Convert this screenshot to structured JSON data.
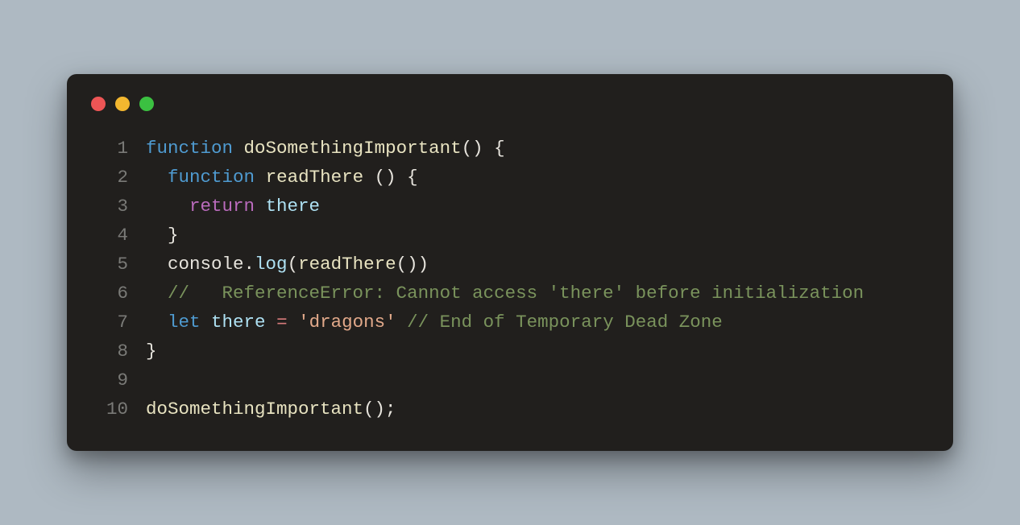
{
  "colors": {
    "background": "#aeb9c2",
    "window": "#211f1d",
    "traffic_red": "#ed5555",
    "traffic_yellow": "#f3b72f",
    "traffic_green": "#3bc041",
    "gutter": "#7a7a77",
    "default": "#e7e4dd",
    "keyword": "#4f9bd1",
    "keyword2": "#ba6bbd",
    "funcname": "#e8e3c1",
    "ident": "#aee1f3",
    "string": "#e2a98a",
    "comment": "#7a935c",
    "operator": "#d87b7b"
  },
  "code": {
    "lines": [
      {
        "num": "1",
        "indent": "",
        "tokens": [
          {
            "cls": "tok-keyword",
            "t": "function"
          },
          {
            "cls": "tok-punct",
            "t": " "
          },
          {
            "cls": "tok-funcname",
            "t": "doSomethingImportant"
          },
          {
            "cls": "tok-punct",
            "t": "() {"
          }
        ]
      },
      {
        "num": "2",
        "indent": "  ",
        "tokens": [
          {
            "cls": "tok-keyword",
            "t": "function"
          },
          {
            "cls": "tok-punct",
            "t": " "
          },
          {
            "cls": "tok-funcname",
            "t": "readThere"
          },
          {
            "cls": "tok-punct",
            "t": " () {"
          }
        ]
      },
      {
        "num": "3",
        "indent": "    ",
        "tokens": [
          {
            "cls": "tok-keyword2",
            "t": "return"
          },
          {
            "cls": "tok-punct",
            "t": " "
          },
          {
            "cls": "tok-ident",
            "t": "there"
          }
        ]
      },
      {
        "num": "4",
        "indent": "  ",
        "tokens": [
          {
            "cls": "tok-punct",
            "t": "}"
          }
        ]
      },
      {
        "num": "5",
        "indent": "  ",
        "tokens": [
          {
            "cls": "tok-obj",
            "t": "console"
          },
          {
            "cls": "tok-punct",
            "t": "."
          },
          {
            "cls": "tok-prop",
            "t": "log"
          },
          {
            "cls": "tok-punct",
            "t": "("
          },
          {
            "cls": "tok-funcname",
            "t": "readThere"
          },
          {
            "cls": "tok-punct",
            "t": "())"
          }
        ]
      },
      {
        "num": "6",
        "indent": "  ",
        "tokens": [
          {
            "cls": "tok-comment",
            "t": "//   ReferenceError: Cannot access 'there' before initialization"
          }
        ]
      },
      {
        "num": "7",
        "indent": "  ",
        "tokens": [
          {
            "cls": "tok-keyword",
            "t": "let"
          },
          {
            "cls": "tok-punct",
            "t": " "
          },
          {
            "cls": "tok-ident",
            "t": "there"
          },
          {
            "cls": "tok-punct",
            "t": " "
          },
          {
            "cls": "tok-op",
            "t": "="
          },
          {
            "cls": "tok-punct",
            "t": " "
          },
          {
            "cls": "tok-string",
            "t": "'dragons'"
          },
          {
            "cls": "tok-punct",
            "t": " "
          },
          {
            "cls": "tok-comment",
            "t": "// End of Temporary Dead Zone"
          }
        ]
      },
      {
        "num": "8",
        "indent": "",
        "tokens": [
          {
            "cls": "tok-punct",
            "t": "}"
          }
        ]
      },
      {
        "num": "9",
        "indent": "",
        "tokens": []
      },
      {
        "num": "10",
        "indent": "",
        "tokens": [
          {
            "cls": "tok-funcname",
            "t": "doSomethingImportant"
          },
          {
            "cls": "tok-punct",
            "t": "();"
          }
        ]
      }
    ]
  }
}
